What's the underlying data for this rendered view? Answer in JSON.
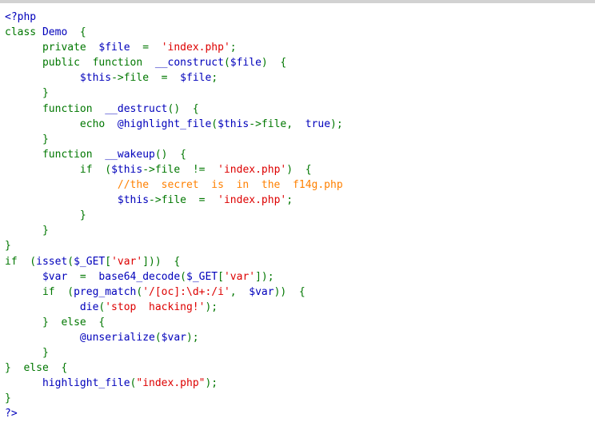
{
  "page": {
    "kind": "php-source-listing",
    "background_color": "#ffffff",
    "top_strip_color": "#d2d2d2"
  },
  "syntax_colors": {
    "keyword_default": "#007700",
    "identifier_variable": "#0000BB",
    "string": "#DD0000",
    "comment": "#FF8000",
    "html": "#000000"
  },
  "source": {
    "language": "PHP",
    "plain_text": "<?php\nclass Demo {\n    private $file = 'index.php';\n    public function __construct($file) {\n        $this->file = $file;\n    }\n    function __destruct() {\n        echo @highlight_file($this->file, true);\n    }\n    function __wakeup() {\n        if ($this->file != 'index.php') {\n            //the secret is in the f14g.php\n            $this->file = 'index.php';\n        }\n    }\n}\nif (isset($_GET['var'])) {\n    $var = base64_decode($_GET['var']);\n    if (preg_match('/[oc]:\\d+:/i', $var)) {\n        die('stop hacking!');\n    } else {\n        @unserialize($var);\n    }\n} else {\n    highlight_file(\"index.php\");\n}\n?>",
    "lines": [
      {
        "n": 1,
        "tokens": [
          {
            "t": "<?php",
            "c": "var"
          }
        ]
      },
      {
        "n": 2,
        "tokens": [
          {
            "t": "class",
            "c": "kw"
          },
          {
            "t": " ",
            "c": "kw"
          },
          {
            "t": "Demo",
            "c": "var"
          },
          {
            "t": "  {",
            "c": "kw"
          }
        ]
      },
      {
        "n": 3,
        "tokens": [
          {
            "t": "      private  ",
            "c": "kw"
          },
          {
            "t": "$file",
            "c": "var"
          },
          {
            "t": "  =  ",
            "c": "kw"
          },
          {
            "t": "'index.php'",
            "c": "str"
          },
          {
            "t": ";",
            "c": "kw"
          }
        ]
      },
      {
        "n": 4,
        "tokens": [
          {
            "t": "      public  function  ",
            "c": "kw"
          },
          {
            "t": "__construct",
            "c": "var"
          },
          {
            "t": "(",
            "c": "kw"
          },
          {
            "t": "$file",
            "c": "var"
          },
          {
            "t": ")  {",
            "c": "kw"
          }
        ]
      },
      {
        "n": 5,
        "tokens": [
          {
            "t": "            ",
            "c": "kw"
          },
          {
            "t": "$this",
            "c": "var"
          },
          {
            "t": "->",
            "c": "kw"
          },
          {
            "t": "file",
            "c": "kw"
          },
          {
            "t": "  =  ",
            "c": "kw"
          },
          {
            "t": "$file",
            "c": "var"
          },
          {
            "t": ";",
            "c": "kw"
          }
        ]
      },
      {
        "n": 6,
        "tokens": [
          {
            "t": "      }",
            "c": "kw"
          }
        ]
      },
      {
        "n": 7,
        "tokens": [
          {
            "t": "      function  ",
            "c": "kw"
          },
          {
            "t": "__destruct",
            "c": "var"
          },
          {
            "t": "()  {",
            "c": "kw"
          }
        ]
      },
      {
        "n": 8,
        "tokens": [
          {
            "t": "            echo  ",
            "c": "kw"
          },
          {
            "t": "@highlight_file",
            "c": "var"
          },
          {
            "t": "(",
            "c": "kw"
          },
          {
            "t": "$this",
            "c": "var"
          },
          {
            "t": "->",
            "c": "kw"
          },
          {
            "t": "file",
            "c": "kw"
          },
          {
            "t": ",  ",
            "c": "kw"
          },
          {
            "t": "true",
            "c": "var"
          },
          {
            "t": ");",
            "c": "kw"
          }
        ]
      },
      {
        "n": 9,
        "tokens": [
          {
            "t": "      }",
            "c": "kw"
          }
        ]
      },
      {
        "n": 10,
        "tokens": [
          {
            "t": "      function  ",
            "c": "kw"
          },
          {
            "t": "__wakeup",
            "c": "var"
          },
          {
            "t": "()  {",
            "c": "kw"
          }
        ]
      },
      {
        "n": 11,
        "tokens": [
          {
            "t": "            if  (",
            "c": "kw"
          },
          {
            "t": "$this",
            "c": "var"
          },
          {
            "t": "->",
            "c": "kw"
          },
          {
            "t": "file",
            "c": "kw"
          },
          {
            "t": "  !=  ",
            "c": "kw"
          },
          {
            "t": "'index.php'",
            "c": "str"
          },
          {
            "t": ")  {",
            "c": "kw"
          }
        ]
      },
      {
        "n": 12,
        "tokens": [
          {
            "t": "                  ",
            "c": "kw"
          },
          {
            "t": "//the  secret  is  in  the  f14g.php",
            "c": "cmt"
          }
        ]
      },
      {
        "n": 13,
        "tokens": [
          {
            "t": "                  ",
            "c": "kw"
          },
          {
            "t": "$this",
            "c": "var"
          },
          {
            "t": "->",
            "c": "kw"
          },
          {
            "t": "file",
            "c": "kw"
          },
          {
            "t": "  =  ",
            "c": "kw"
          },
          {
            "t": "'index.php'",
            "c": "str"
          },
          {
            "t": ";",
            "c": "kw"
          }
        ]
      },
      {
        "n": 14,
        "tokens": [
          {
            "t": "            }",
            "c": "kw"
          }
        ]
      },
      {
        "n": 15,
        "tokens": [
          {
            "t": "      }",
            "c": "kw"
          }
        ]
      },
      {
        "n": 16,
        "tokens": [
          {
            "t": "}",
            "c": "kw"
          }
        ]
      },
      {
        "n": 17,
        "tokens": [
          {
            "t": "if  (",
            "c": "kw"
          },
          {
            "t": "isset",
            "c": "var"
          },
          {
            "t": "(",
            "c": "kw"
          },
          {
            "t": "$_GET",
            "c": "var"
          },
          {
            "t": "[",
            "c": "kw"
          },
          {
            "t": "'var'",
            "c": "str"
          },
          {
            "t": "]))  {",
            "c": "kw"
          }
        ]
      },
      {
        "n": 18,
        "tokens": [
          {
            "t": "      ",
            "c": "kw"
          },
          {
            "t": "$var",
            "c": "var"
          },
          {
            "t": "  =  ",
            "c": "kw"
          },
          {
            "t": "base64_decode",
            "c": "var"
          },
          {
            "t": "(",
            "c": "kw"
          },
          {
            "t": "$_GET",
            "c": "var"
          },
          {
            "t": "[",
            "c": "kw"
          },
          {
            "t": "'var'",
            "c": "str"
          },
          {
            "t": "]);",
            "c": "kw"
          }
        ]
      },
      {
        "n": 19,
        "tokens": [
          {
            "t": "      if  (",
            "c": "kw"
          },
          {
            "t": "preg_match",
            "c": "var"
          },
          {
            "t": "(",
            "c": "kw"
          },
          {
            "t": "'/[oc]:\\d+:/i'",
            "c": "str"
          },
          {
            "t": ",  ",
            "c": "kw"
          },
          {
            "t": "$var",
            "c": "var"
          },
          {
            "t": "))  {",
            "c": "kw"
          }
        ]
      },
      {
        "n": 20,
        "tokens": [
          {
            "t": "            ",
            "c": "kw"
          },
          {
            "t": "die",
            "c": "var"
          },
          {
            "t": "(",
            "c": "kw"
          },
          {
            "t": "'stop  hacking!'",
            "c": "str"
          },
          {
            "t": ");",
            "c": "kw"
          }
        ]
      },
      {
        "n": 21,
        "tokens": [
          {
            "t": "      }  else  {",
            "c": "kw"
          }
        ]
      },
      {
        "n": 22,
        "tokens": [
          {
            "t": "            ",
            "c": "kw"
          },
          {
            "t": "@unserialize",
            "c": "var"
          },
          {
            "t": "(",
            "c": "kw"
          },
          {
            "t": "$var",
            "c": "var"
          },
          {
            "t": ");",
            "c": "kw"
          }
        ]
      },
      {
        "n": 23,
        "tokens": [
          {
            "t": "      }",
            "c": "kw"
          }
        ]
      },
      {
        "n": 24,
        "tokens": [
          {
            "t": "}  else  {",
            "c": "kw"
          }
        ]
      },
      {
        "n": 25,
        "tokens": [
          {
            "t": "      ",
            "c": "kw"
          },
          {
            "t": "highlight_file",
            "c": "var"
          },
          {
            "t": "(",
            "c": "kw"
          },
          {
            "t": "\"index.php\"",
            "c": "str"
          },
          {
            "t": ");",
            "c": "kw"
          }
        ]
      },
      {
        "n": 26,
        "tokens": [
          {
            "t": "}",
            "c": "kw"
          }
        ]
      },
      {
        "n": 27,
        "tokens": [
          {
            "t": "?>",
            "c": "var"
          }
        ]
      }
    ]
  }
}
